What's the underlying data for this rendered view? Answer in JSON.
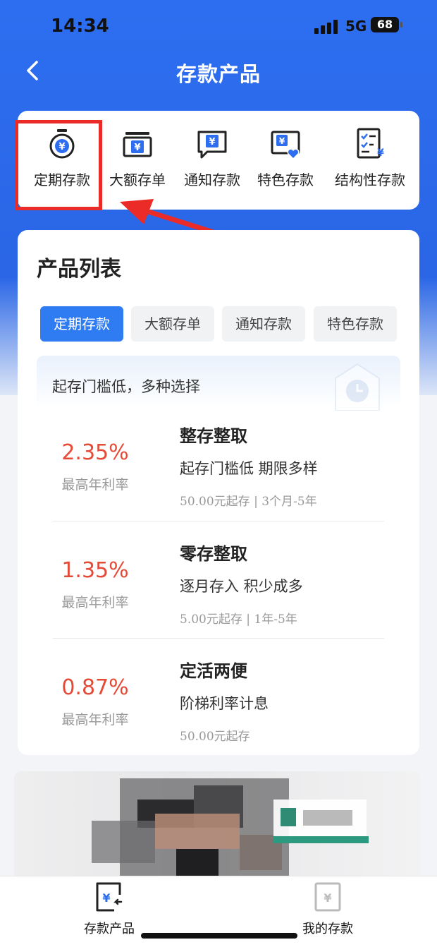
{
  "status_bar": {
    "time": "14:34",
    "network": "5G",
    "battery": "68"
  },
  "nav": {
    "title": "存款产品"
  },
  "categories": [
    {
      "label": "定期存款",
      "icon": "stopwatch-yuan-icon"
    },
    {
      "label": "大额存单",
      "icon": "box-yuan-icon"
    },
    {
      "label": "通知存款",
      "icon": "message-yuan-icon"
    },
    {
      "label": "特色存款",
      "icon": "heart-card-yuan-icon"
    },
    {
      "label": "结构性存款",
      "icon": "checklist-yuan-icon"
    }
  ],
  "product_list": {
    "title": "产品列表",
    "tabs": [
      {
        "label": "定期存款",
        "active": true
      },
      {
        "label": "大额存单",
        "active": false
      },
      {
        "label": "通知存款",
        "active": false
      },
      {
        "label": "特色存款",
        "active": false
      }
    ],
    "banner_text": "起存门槛低，多种选择",
    "products": [
      {
        "rate": "2.35%",
        "rate_label": "最高年利率",
        "name": "整存整取",
        "desc": "起存门槛低  期限多样",
        "meta": "50.00元起存 | 3个月-5年"
      },
      {
        "rate": "1.35%",
        "rate_label": "最高年利率",
        "name": "零存整取",
        "desc": "逐月存入  积少成多",
        "meta": "5.00元起存 | 1年-5年"
      },
      {
        "rate": "0.87%",
        "rate_label": "最高年利率",
        "name": "定活两便",
        "desc": "阶梯利率计息",
        "meta": "50.00元起存"
      }
    ]
  },
  "tab_bar": {
    "items": [
      {
        "label": "存款产品",
        "icon": "deposit-products-icon",
        "active": true
      },
      {
        "label": "我的存款",
        "icon": "my-deposits-icon",
        "active": false
      }
    ]
  },
  "colors": {
    "brand_blue": "#2d6ef0",
    "rate_red": "#e54a37",
    "highlight_red": "#ea2b27",
    "tab_active": "#2f7cf2"
  }
}
